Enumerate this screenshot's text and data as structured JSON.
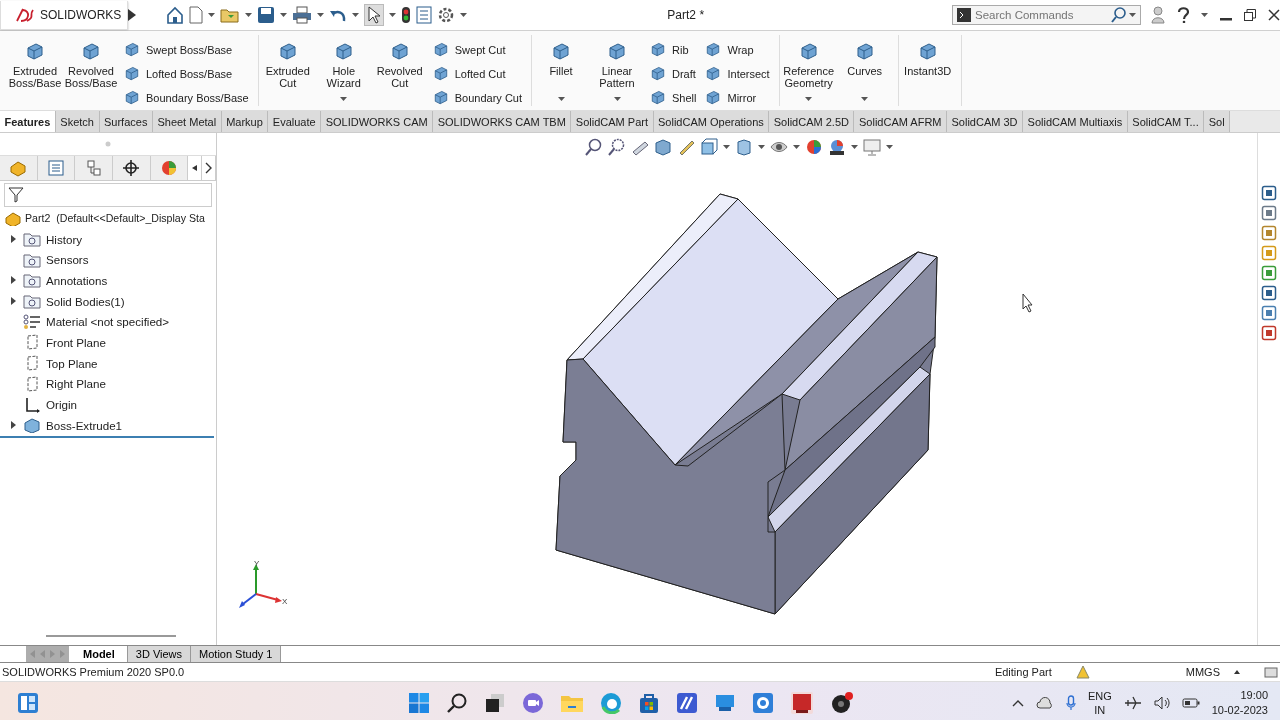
{
  "title_bar": {
    "app_name": "SOLIDWORKS",
    "document_title": "Part2 *",
    "search": {
      "placeholder": "Search Commands"
    }
  },
  "ribbon": {
    "groups": [
      {
        "items": [
          {
            "kind": "large",
            "label": "Extruded Boss/Base",
            "dropdown": false
          },
          {
            "kind": "large",
            "label": "Revolved Boss/Base",
            "dropdown": false
          },
          {
            "kind": "small",
            "label": "Swept Boss/Base",
            "dropdown": false
          },
          {
            "kind": "small",
            "label": "Lofted Boss/Base",
            "dropdown": false
          },
          {
            "kind": "small",
            "label": "Boundary Boss/Base",
            "dropdown": false
          }
        ]
      },
      {
        "items": [
          {
            "kind": "large",
            "label": "Extruded Cut",
            "dropdown": false
          },
          {
            "kind": "large",
            "label": "Hole Wizard",
            "dropdown": true
          },
          {
            "kind": "large",
            "label": "Revolved Cut",
            "dropdown": false
          },
          {
            "kind": "small",
            "label": "Swept Cut",
            "dropdown": false
          },
          {
            "kind": "small",
            "label": "Lofted Cut",
            "dropdown": false
          },
          {
            "kind": "small",
            "label": "Boundary Cut",
            "dropdown": false
          }
        ]
      },
      {
        "items": [
          {
            "kind": "large",
            "label": "Fillet",
            "dropdown": true
          },
          {
            "kind": "large",
            "label": "Linear Pattern",
            "dropdown": true
          },
          {
            "kind": "small",
            "label": "Rib",
            "dropdown": false
          },
          {
            "kind": "small",
            "label": "Draft",
            "dropdown": false
          },
          {
            "kind": "small",
            "label": "Shell",
            "dropdown": false
          },
          {
            "kind": "small",
            "label": "Wrap",
            "dropdown": false
          },
          {
            "kind": "small",
            "label": "Intersect",
            "dropdown": false
          },
          {
            "kind": "small",
            "label": "Mirror",
            "dropdown": false
          }
        ]
      },
      {
        "items": [
          {
            "kind": "large",
            "label": "Reference Geometry",
            "dropdown": true
          },
          {
            "kind": "large",
            "label": "Curves",
            "dropdown": true
          }
        ]
      },
      {
        "items": [
          {
            "kind": "large",
            "label": "Instant3D",
            "dropdown": false
          }
        ]
      }
    ]
  },
  "command_tabs": [
    {
      "label": "Features",
      "selected": true
    },
    {
      "label": "Sketch",
      "selected": false
    },
    {
      "label": "Surfaces",
      "selected": false
    },
    {
      "label": "Sheet Metal",
      "selected": false
    },
    {
      "label": "Markup",
      "selected": false
    },
    {
      "label": "Evaluate",
      "selected": false
    },
    {
      "label": "SOLIDWORKS CAM",
      "selected": false
    },
    {
      "label": "SOLIDWORKS CAM TBM",
      "selected": false
    },
    {
      "label": "SolidCAM Part",
      "selected": false
    },
    {
      "label": "SolidCAM Operations",
      "selected": false
    },
    {
      "label": "SolidCAM 2.5D",
      "selected": false
    },
    {
      "label": "SolidCAM AFRM",
      "selected": false
    },
    {
      "label": "SolidCAM 3D",
      "selected": false
    },
    {
      "label": "SolidCAM Multiaxis",
      "selected": false
    },
    {
      "label": "SolidCAM T...",
      "selected": false
    },
    {
      "label": "Sol",
      "selected": false
    }
  ],
  "feature_tree": {
    "root": {
      "label": "Part2  (Default<<Default>_Display Sta"
    },
    "items": [
      {
        "label": "History",
        "kind": "folder",
        "expandable": true
      },
      {
        "label": "Sensors",
        "kind": "folder",
        "expandable": false
      },
      {
        "label": "Annotations",
        "kind": "folder",
        "expandable": true
      },
      {
        "label": "Solid Bodies(1)",
        "kind": "folder",
        "expandable": true
      },
      {
        "label": "Material <not specified>",
        "kind": "material",
        "expandable": false
      },
      {
        "label": "Front Plane",
        "kind": "plane",
        "expandable": false
      },
      {
        "label": "Top Plane",
        "kind": "plane",
        "expandable": false
      },
      {
        "label": "Right Plane",
        "kind": "plane",
        "expandable": false
      },
      {
        "label": "Origin",
        "kind": "origin",
        "expandable": false
      },
      {
        "label": "Boss-Extrude1",
        "kind": "feature",
        "expandable": true
      }
    ]
  },
  "triad": {
    "y_label": "Y",
    "x_label": "X"
  },
  "bottom_tabs": [
    {
      "label": "Model",
      "selected": true
    },
    {
      "label": "3D Views",
      "selected": false
    },
    {
      "label": "Motion Study 1",
      "selected": false
    }
  ],
  "status_bar": {
    "version": "SOLIDWORKS Premium 2020 SP0.0",
    "mode": "Editing Part",
    "units": "MMGS"
  },
  "taskbar": {
    "language": "ENG",
    "region": "IN",
    "time": "19:00",
    "date": "10-02-2023"
  }
}
